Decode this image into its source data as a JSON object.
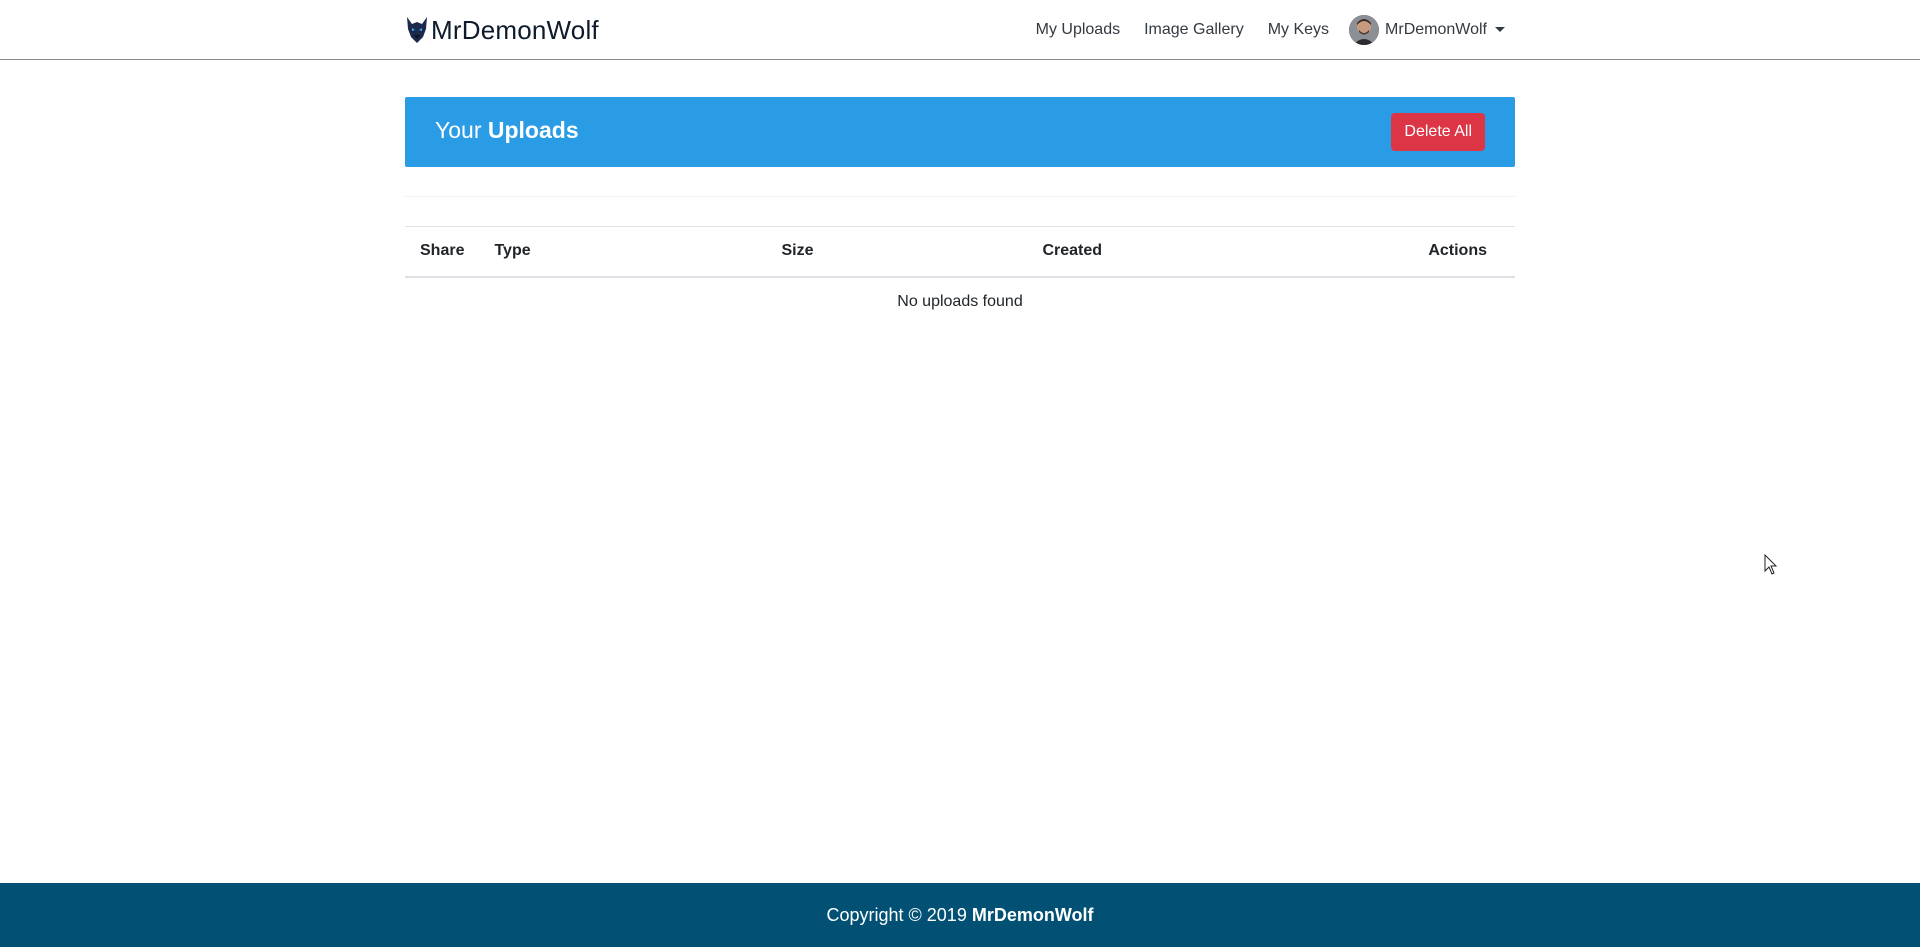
{
  "navbar": {
    "brand_name": "MrDemonWolf",
    "links": [
      {
        "label": "My Uploads"
      },
      {
        "label": "Image Gallery"
      },
      {
        "label": "My Keys"
      }
    ],
    "user": {
      "name": "MrDemonWolf"
    }
  },
  "banner": {
    "title_prefix": "Your",
    "title_bold": "Uploads",
    "delete_all_label": "Delete All",
    "background_color": "#2a9ce5",
    "button_color": "#dc3545"
  },
  "table": {
    "columns": [
      "Share",
      "Type",
      "Size",
      "Created",
      "Actions"
    ],
    "empty_message": "No uploads found"
  },
  "footer": {
    "copyright_prefix": "Copyright © 2019",
    "owner": "MrDemonWolf",
    "background_color": "#025174"
  }
}
